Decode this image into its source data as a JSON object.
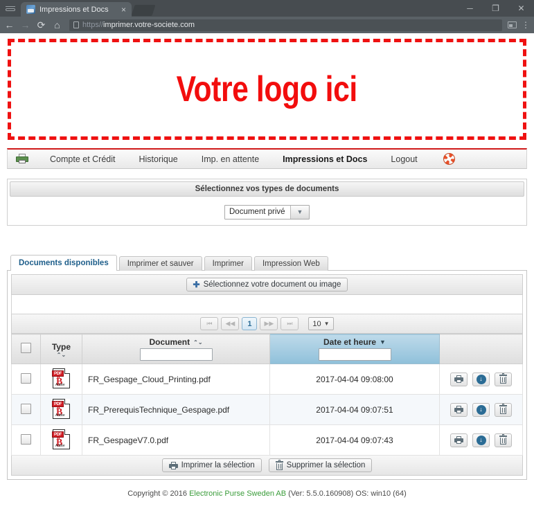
{
  "browser": {
    "tab_title": "Impressions et Docs",
    "tab_close": "×",
    "url_scheme": "https//",
    "url_host": "imprimer.votre-societe.com",
    "back_icon": "←",
    "forward_icon": "→",
    "reload_icon": "⟳",
    "home_icon": "⌂",
    "minimize": "─",
    "maximize": "❐",
    "close": "✕",
    "menu_dots": "⋮"
  },
  "logo": {
    "placeholder_text": "Votre logo ici",
    "color": "#f20d0d"
  },
  "nav": {
    "accent_color": "#cf1a1a",
    "items": [
      {
        "label": "Compte et Crédit",
        "active": false
      },
      {
        "label": "Historique",
        "active": false
      },
      {
        "label": "Imp. en attente",
        "active": false
      },
      {
        "label": "Impressions et Docs",
        "active": true
      },
      {
        "label": "Logout",
        "active": false
      }
    ]
  },
  "doctype_panel": {
    "title": "Sélectionnez vos types de documents",
    "selected": "Document privé",
    "arrow": "▼"
  },
  "tabs": [
    {
      "label": "Documents disponibles",
      "active": true
    },
    {
      "label": "Imprimer et sauver",
      "active": false
    },
    {
      "label": "Imprimer",
      "active": false
    },
    {
      "label": "Impression Web",
      "active": false
    }
  ],
  "upload": {
    "button_label": "Sélectionnez votre document ou image",
    "plus": "✚"
  },
  "pagination": {
    "first": "⏮",
    "prev": "◀◀",
    "current_page": "1",
    "next": "▶▶",
    "last": "⏭",
    "page_size": "10",
    "page_size_caret": "▼"
  },
  "table": {
    "columns": {
      "type": "Type",
      "document": "Document",
      "datetime": "Date et heure"
    },
    "sort_updown": "⌃⌄",
    "sort_desc": "▼",
    "document_filter_value": "",
    "datetime_filter_value": "",
    "sorted_column": "datetime",
    "rows": [
      {
        "type_icon": "pdf-icon",
        "type_label": "PDF",
        "document": "FR_Gespage_Cloud_Printing.pdf",
        "datetime": "2017-04-04 09:08:00"
      },
      {
        "type_icon": "pdf-icon",
        "type_label": "PDF",
        "document": "FR_PrerequisTechnique_Gespage.pdf",
        "datetime": "2017-04-04 09:07:51"
      },
      {
        "type_icon": "pdf-icon",
        "type_label": "PDF",
        "document": "FR_GespageV7.0.pdf",
        "datetime": "2017-04-04 09:07:43"
      }
    ],
    "row_actions": {
      "print": "print-icon",
      "download": "download-icon",
      "delete": "trash-icon",
      "download_glyph": "↓"
    }
  },
  "bulk_actions": {
    "print_selection": "Imprimer la sélection",
    "delete_selection": "Supprimer la sélection"
  },
  "footer": {
    "prefix": "Copyright © 2016 ",
    "company": "Electronic Purse Sweden AB",
    "suffix": " (Ver: 5.5.0.160908) OS: win10 (64)"
  }
}
